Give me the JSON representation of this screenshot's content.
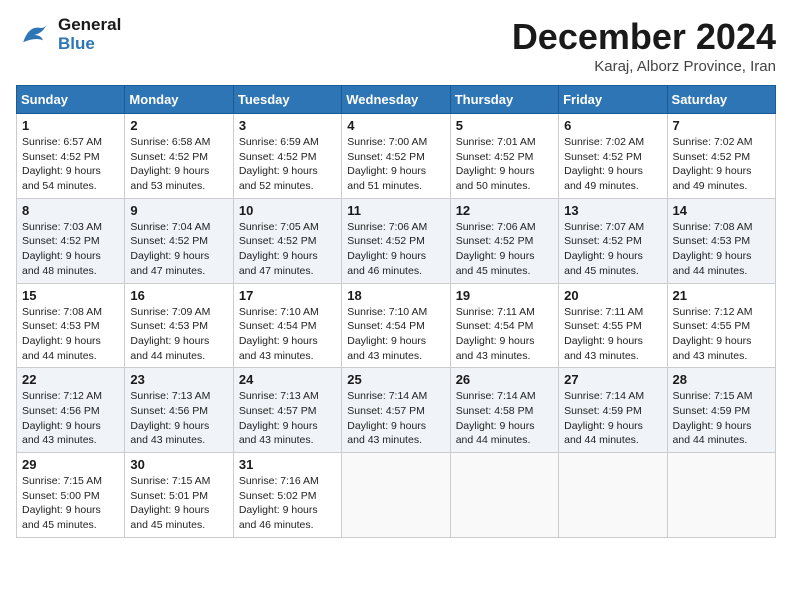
{
  "header": {
    "logo_text_general": "General",
    "logo_text_blue": "Blue",
    "main_title": "December 2024",
    "subtitle": "Karaj, Alborz Province, Iran"
  },
  "calendar": {
    "days_of_week": [
      "Sunday",
      "Monday",
      "Tuesday",
      "Wednesday",
      "Thursday",
      "Friday",
      "Saturday"
    ],
    "weeks": [
      [
        {
          "day": "1",
          "sunrise": "6:57 AM",
          "sunset": "4:52 PM",
          "daylight": "9 hours and 54 minutes."
        },
        {
          "day": "2",
          "sunrise": "6:58 AM",
          "sunset": "4:52 PM",
          "daylight": "9 hours and 53 minutes."
        },
        {
          "day": "3",
          "sunrise": "6:59 AM",
          "sunset": "4:52 PM",
          "daylight": "9 hours and 52 minutes."
        },
        {
          "day": "4",
          "sunrise": "7:00 AM",
          "sunset": "4:52 PM",
          "daylight": "9 hours and 51 minutes."
        },
        {
          "day": "5",
          "sunrise": "7:01 AM",
          "sunset": "4:52 PM",
          "daylight": "9 hours and 50 minutes."
        },
        {
          "day": "6",
          "sunrise": "7:02 AM",
          "sunset": "4:52 PM",
          "daylight": "9 hours and 49 minutes."
        },
        {
          "day": "7",
          "sunrise": "7:02 AM",
          "sunset": "4:52 PM",
          "daylight": "9 hours and 49 minutes."
        }
      ],
      [
        {
          "day": "8",
          "sunrise": "7:03 AM",
          "sunset": "4:52 PM",
          "daylight": "9 hours and 48 minutes."
        },
        {
          "day": "9",
          "sunrise": "7:04 AM",
          "sunset": "4:52 PM",
          "daylight": "9 hours and 47 minutes."
        },
        {
          "day": "10",
          "sunrise": "7:05 AM",
          "sunset": "4:52 PM",
          "daylight": "9 hours and 47 minutes."
        },
        {
          "day": "11",
          "sunrise": "7:06 AM",
          "sunset": "4:52 PM",
          "daylight": "9 hours and 46 minutes."
        },
        {
          "day": "12",
          "sunrise": "7:06 AM",
          "sunset": "4:52 PM",
          "daylight": "9 hours and 45 minutes."
        },
        {
          "day": "13",
          "sunrise": "7:07 AM",
          "sunset": "4:52 PM",
          "daylight": "9 hours and 45 minutes."
        },
        {
          "day": "14",
          "sunrise": "7:08 AM",
          "sunset": "4:53 PM",
          "daylight": "9 hours and 44 minutes."
        }
      ],
      [
        {
          "day": "15",
          "sunrise": "7:08 AM",
          "sunset": "4:53 PM",
          "daylight": "9 hours and 44 minutes."
        },
        {
          "day": "16",
          "sunrise": "7:09 AM",
          "sunset": "4:53 PM",
          "daylight": "9 hours and 44 minutes."
        },
        {
          "day": "17",
          "sunrise": "7:10 AM",
          "sunset": "4:54 PM",
          "daylight": "9 hours and 43 minutes."
        },
        {
          "day": "18",
          "sunrise": "7:10 AM",
          "sunset": "4:54 PM",
          "daylight": "9 hours and 43 minutes."
        },
        {
          "day": "19",
          "sunrise": "7:11 AM",
          "sunset": "4:54 PM",
          "daylight": "9 hours and 43 minutes."
        },
        {
          "day": "20",
          "sunrise": "7:11 AM",
          "sunset": "4:55 PM",
          "daylight": "9 hours and 43 minutes."
        },
        {
          "day": "21",
          "sunrise": "7:12 AM",
          "sunset": "4:55 PM",
          "daylight": "9 hours and 43 minutes."
        }
      ],
      [
        {
          "day": "22",
          "sunrise": "7:12 AM",
          "sunset": "4:56 PM",
          "daylight": "9 hours and 43 minutes."
        },
        {
          "day": "23",
          "sunrise": "7:13 AM",
          "sunset": "4:56 PM",
          "daylight": "9 hours and 43 minutes."
        },
        {
          "day": "24",
          "sunrise": "7:13 AM",
          "sunset": "4:57 PM",
          "daylight": "9 hours and 43 minutes."
        },
        {
          "day": "25",
          "sunrise": "7:14 AM",
          "sunset": "4:57 PM",
          "daylight": "9 hours and 43 minutes."
        },
        {
          "day": "26",
          "sunrise": "7:14 AM",
          "sunset": "4:58 PM",
          "daylight": "9 hours and 44 minutes."
        },
        {
          "day": "27",
          "sunrise": "7:14 AM",
          "sunset": "4:59 PM",
          "daylight": "9 hours and 44 minutes."
        },
        {
          "day": "28",
          "sunrise": "7:15 AM",
          "sunset": "4:59 PM",
          "daylight": "9 hours and 44 minutes."
        }
      ],
      [
        {
          "day": "29",
          "sunrise": "7:15 AM",
          "sunset": "5:00 PM",
          "daylight": "9 hours and 45 minutes."
        },
        {
          "day": "30",
          "sunrise": "7:15 AM",
          "sunset": "5:01 PM",
          "daylight": "9 hours and 45 minutes."
        },
        {
          "day": "31",
          "sunrise": "7:16 AM",
          "sunset": "5:02 PM",
          "daylight": "9 hours and 46 minutes."
        },
        null,
        null,
        null,
        null
      ]
    ]
  }
}
